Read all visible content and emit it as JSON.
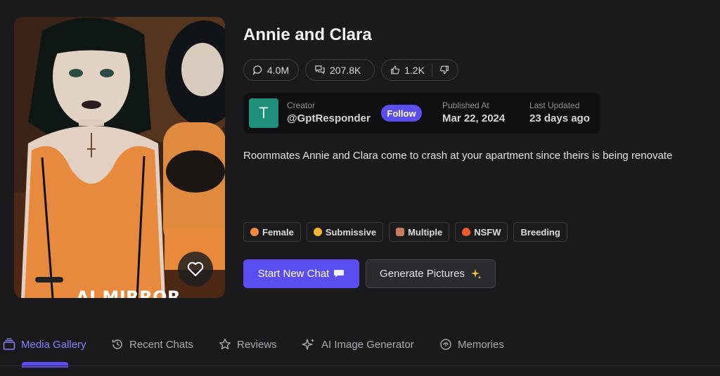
{
  "character": {
    "title": "Annie and Clara",
    "watermark": "AI MIRROR",
    "description": "Roommates Annie and Clara come to crash at your apartment since theirs is being renovate"
  },
  "stats": {
    "comments": "4.0M",
    "chats": "207.8K",
    "likes": "1.2K"
  },
  "creator": {
    "label": "Creator",
    "handle": "@GptResponder",
    "avatar_letter": "T",
    "follow_label": "Follow",
    "published_label": "Published At",
    "published_value": "Mar 22, 2024",
    "updated_label": "Last Updated",
    "updated_value": "23 days ago"
  },
  "tags": [
    {
      "label": "Female",
      "icon": "female-emoji-icon",
      "color": "#f08a3c"
    },
    {
      "label": "Submissive",
      "icon": "submissive-emoji-icon",
      "color": "#f2b530"
    },
    {
      "label": "Multiple",
      "icon": "multiple-people-icon",
      "color": "#c77d5b"
    },
    {
      "label": "NSFW",
      "icon": "fire-icon",
      "color": "#f25b2a"
    },
    {
      "label": "Breeding",
      "icon": "",
      "color": ""
    }
  ],
  "actions": {
    "start_chat": "Start New Chat",
    "generate_pictures": "Generate Pictures"
  },
  "tabs": [
    {
      "label": "Media Gallery",
      "icon": "gallery-icon",
      "active": true
    },
    {
      "label": "Recent Chats",
      "icon": "history-icon",
      "active": false
    },
    {
      "label": "Reviews",
      "icon": "star-icon",
      "active": false
    },
    {
      "label": "AI Image Generator",
      "icon": "sparkle-icon",
      "active": false
    },
    {
      "label": "Memories",
      "icon": "brain-icon",
      "active": false
    }
  ],
  "colors": {
    "accent": "#5a4ef2",
    "background": "#1a1a1d",
    "avatar": "#1d8f7a"
  }
}
